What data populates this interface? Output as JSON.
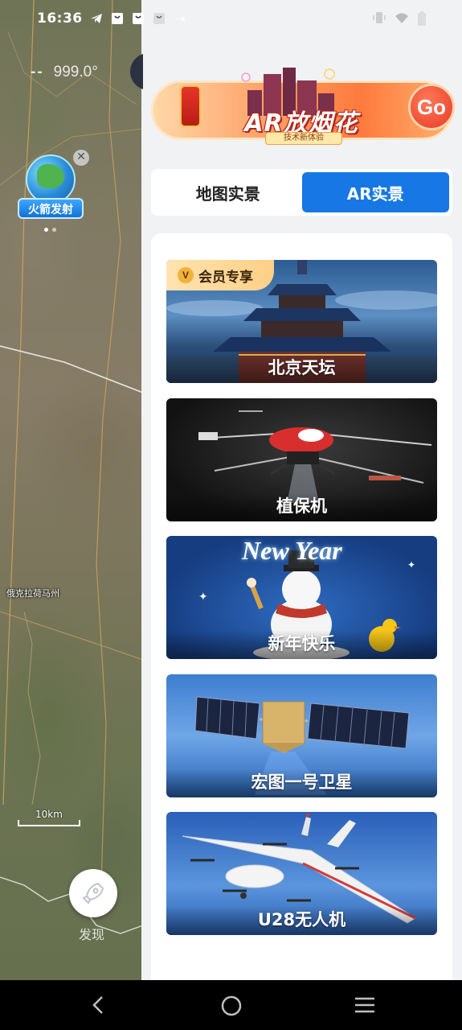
{
  "status_bar": {
    "time": "16:36"
  },
  "map": {
    "heading_dash": "--",
    "heading_value": "999.0°",
    "rocket_badge_label": "火箭发射",
    "place_label": "俄克拉荷马州",
    "scale_label": "10km",
    "discover_label": "发现"
  },
  "banner": {
    "title": "AR放烟花",
    "subtitle": "技术新体验",
    "go_label": "Go"
  },
  "tabs": [
    {
      "label": "地图实景",
      "active": false
    },
    {
      "label": "AR实景",
      "active": true
    }
  ],
  "scenes": [
    {
      "label": "北京天坛",
      "vip_tag": "会员专享",
      "vip_icon": "V"
    },
    {
      "label": "植保机"
    },
    {
      "label": "新年快乐",
      "art_text": "New Year"
    },
    {
      "label": "宏图一号卫星"
    },
    {
      "label": "U28无人机"
    }
  ],
  "colors": {
    "accent": "#1677e5",
    "panel_bg": "#f1f2f4",
    "vip_gold": "#ffcf86"
  },
  "icons": {
    "nav_back": "chevron-left-icon",
    "nav_home": "circle-home-icon",
    "nav_menu": "menu-icon",
    "discover": "rocket-icon"
  }
}
